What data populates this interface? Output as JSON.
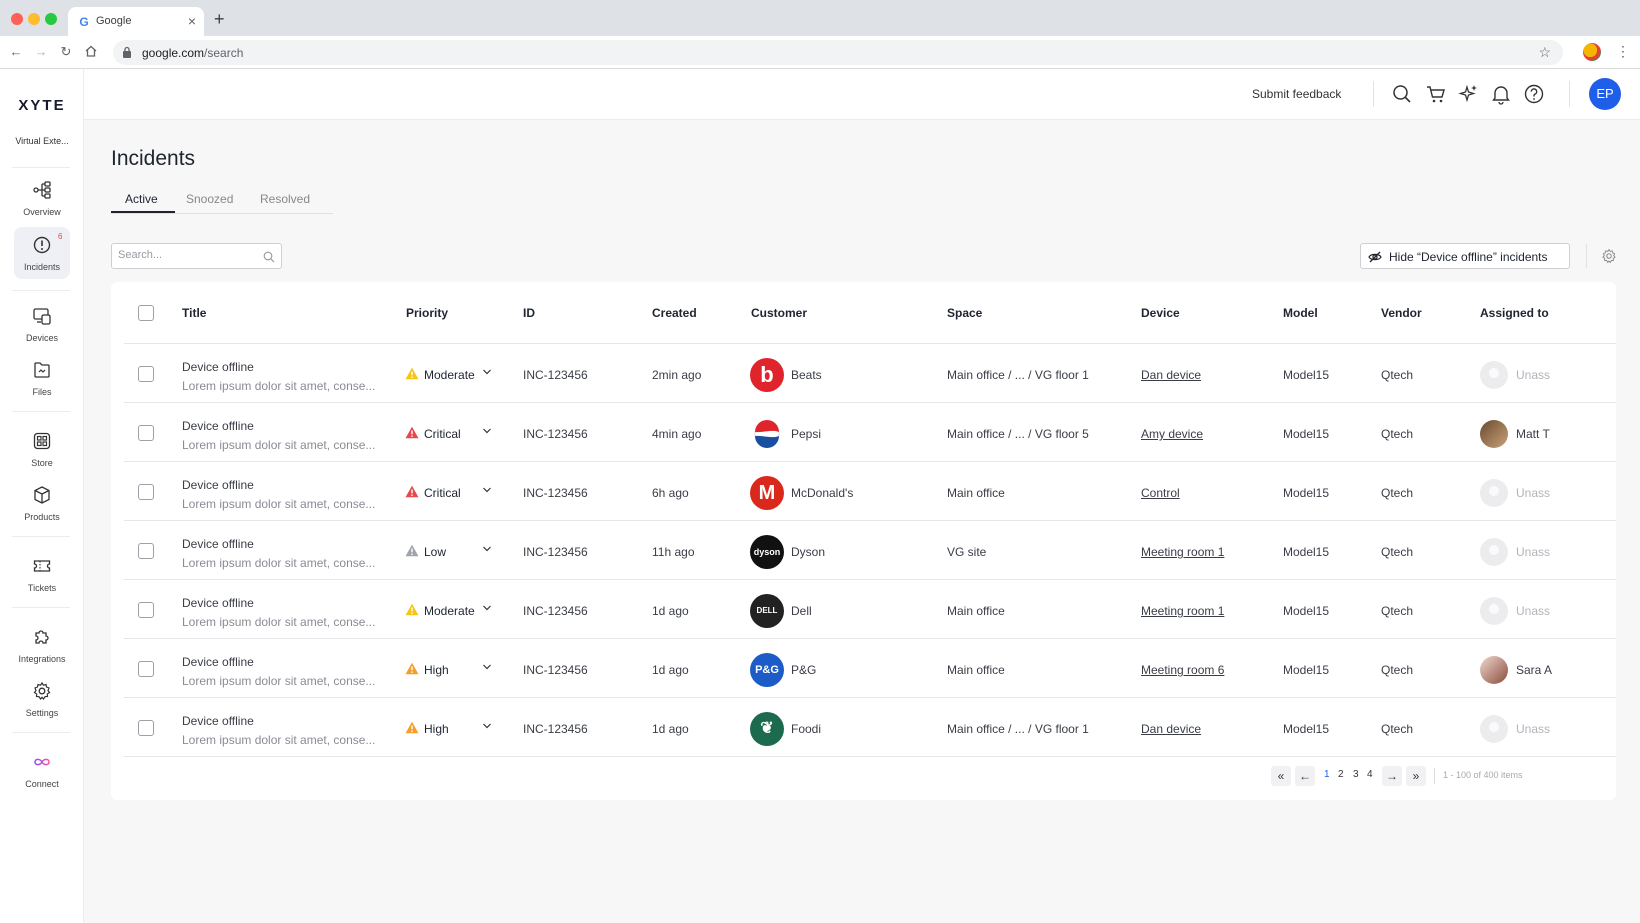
{
  "browser": {
    "tab_title": "Google",
    "url_host": "google.com",
    "url_path": "/search"
  },
  "app": {
    "logo": "XYTE",
    "org_name": "Virtual Exte...",
    "sidebar": {
      "overview": "Overview",
      "incidents": "Incidents",
      "incidents_badge": "6",
      "devices": "Devices",
      "files": "Files",
      "store": "Store",
      "products": "Products",
      "tickets": "Tickets",
      "integrations": "Integrations",
      "settings": "Settings",
      "connect": "Connect"
    },
    "topbar": {
      "feedback": "Submit feedback",
      "avatar_initials": "EP"
    },
    "page_title": "Incidents",
    "tabs": [
      "Active",
      "Snoozed",
      "Resolved"
    ],
    "search_placeholder": "Search...",
    "hide_button": "Hide “Device offline” incidents",
    "columns": {
      "title": "Title",
      "priority": "Priority",
      "id": "ID",
      "created": "Created",
      "customer": "Customer",
      "space": "Space",
      "device": "Device",
      "model": "Model",
      "vendor": "Vendor",
      "assigned": "Assigned to"
    },
    "rows": [
      {
        "title": "Device offline",
        "desc": "Lorem ipsum dolor sit amet, conse...",
        "priority": "Moderate",
        "priority_color": "#f5c518",
        "id": "INC-123456",
        "created": "2min ago",
        "customer": "Beats",
        "space": "Main office / ... / VG floor 1",
        "device": "Dan device",
        "model": "Model15",
        "vendor": "Qtech",
        "assignee": "Unass"
      },
      {
        "title": "Device offline",
        "desc": "Lorem ipsum dolor sit amet, conse...",
        "priority": "Critical",
        "priority_color": "#e5484d",
        "id": "INC-123456",
        "created": "4min ago",
        "customer": "Pepsi",
        "space": "Main office / ... / VG floor 5",
        "device": "Amy device",
        "model": "Model15",
        "vendor": "Qtech",
        "assignee": "Matt T"
      },
      {
        "title": "Device offline",
        "desc": "Lorem ipsum dolor sit amet, conse...",
        "priority": "Critical",
        "priority_color": "#e5484d",
        "id": "INC-123456",
        "created": "6h ago",
        "customer": "McDonald's",
        "space": "Main office",
        "device": "Control",
        "model": "Model15",
        "vendor": "Qtech",
        "assignee": "Unass"
      },
      {
        "title": "Device offline",
        "desc": "Lorem ipsum dolor sit amet, conse...",
        "priority": "Low",
        "priority_color": "#a0a3ab",
        "id": "INC-123456",
        "created": "11h ago",
        "customer": "Dyson",
        "space": "VG site",
        "device": "Meeting room 1",
        "model": "Model15",
        "vendor": "Qtech",
        "assignee": "Unass"
      },
      {
        "title": "Device offline",
        "desc": "Lorem ipsum dolor sit amet, conse...",
        "priority": "Moderate",
        "priority_color": "#f5c518",
        "id": "INC-123456",
        "created": "1d ago",
        "customer": "Dell",
        "space": "Main office",
        "device": "Meeting room 1",
        "model": "Model15",
        "vendor": "Qtech",
        "assignee": "Unass"
      },
      {
        "title": "Device offline",
        "desc": "Lorem ipsum dolor sit amet, conse...",
        "priority": "High",
        "priority_color": "#f59e2b",
        "id": "INC-123456",
        "created": "1d ago",
        "customer": "P&G",
        "space": "Main office",
        "device": "Meeting room 6",
        "model": "Model15",
        "vendor": "Qtech",
        "assignee": "Sara A"
      },
      {
        "title": "Device offline",
        "desc": "Lorem ipsum dolor sit amet, conse...",
        "priority": "High",
        "priority_color": "#f59e2b",
        "id": "INC-123456",
        "created": "1d ago",
        "customer": "Foodi",
        "space": "Main office / ... / VG floor 1",
        "device": "Dan device",
        "model": "Model15",
        "vendor": "Qtech",
        "assignee": "Unass"
      }
    ],
    "pagination": {
      "pages": [
        "1",
        "2",
        "3",
        "4"
      ],
      "current": "1",
      "info": "1 - 100 of 400 items"
    },
    "colors": {
      "accent": "#1f5ee8",
      "beats": "#e0242c",
      "pepsi": "#1a4fa0",
      "mcdonalds": "#da291c",
      "dyson": "#111111",
      "dell": "#222222",
      "pg": "#1d5cc7",
      "foodi": "#1d6b4f"
    }
  }
}
